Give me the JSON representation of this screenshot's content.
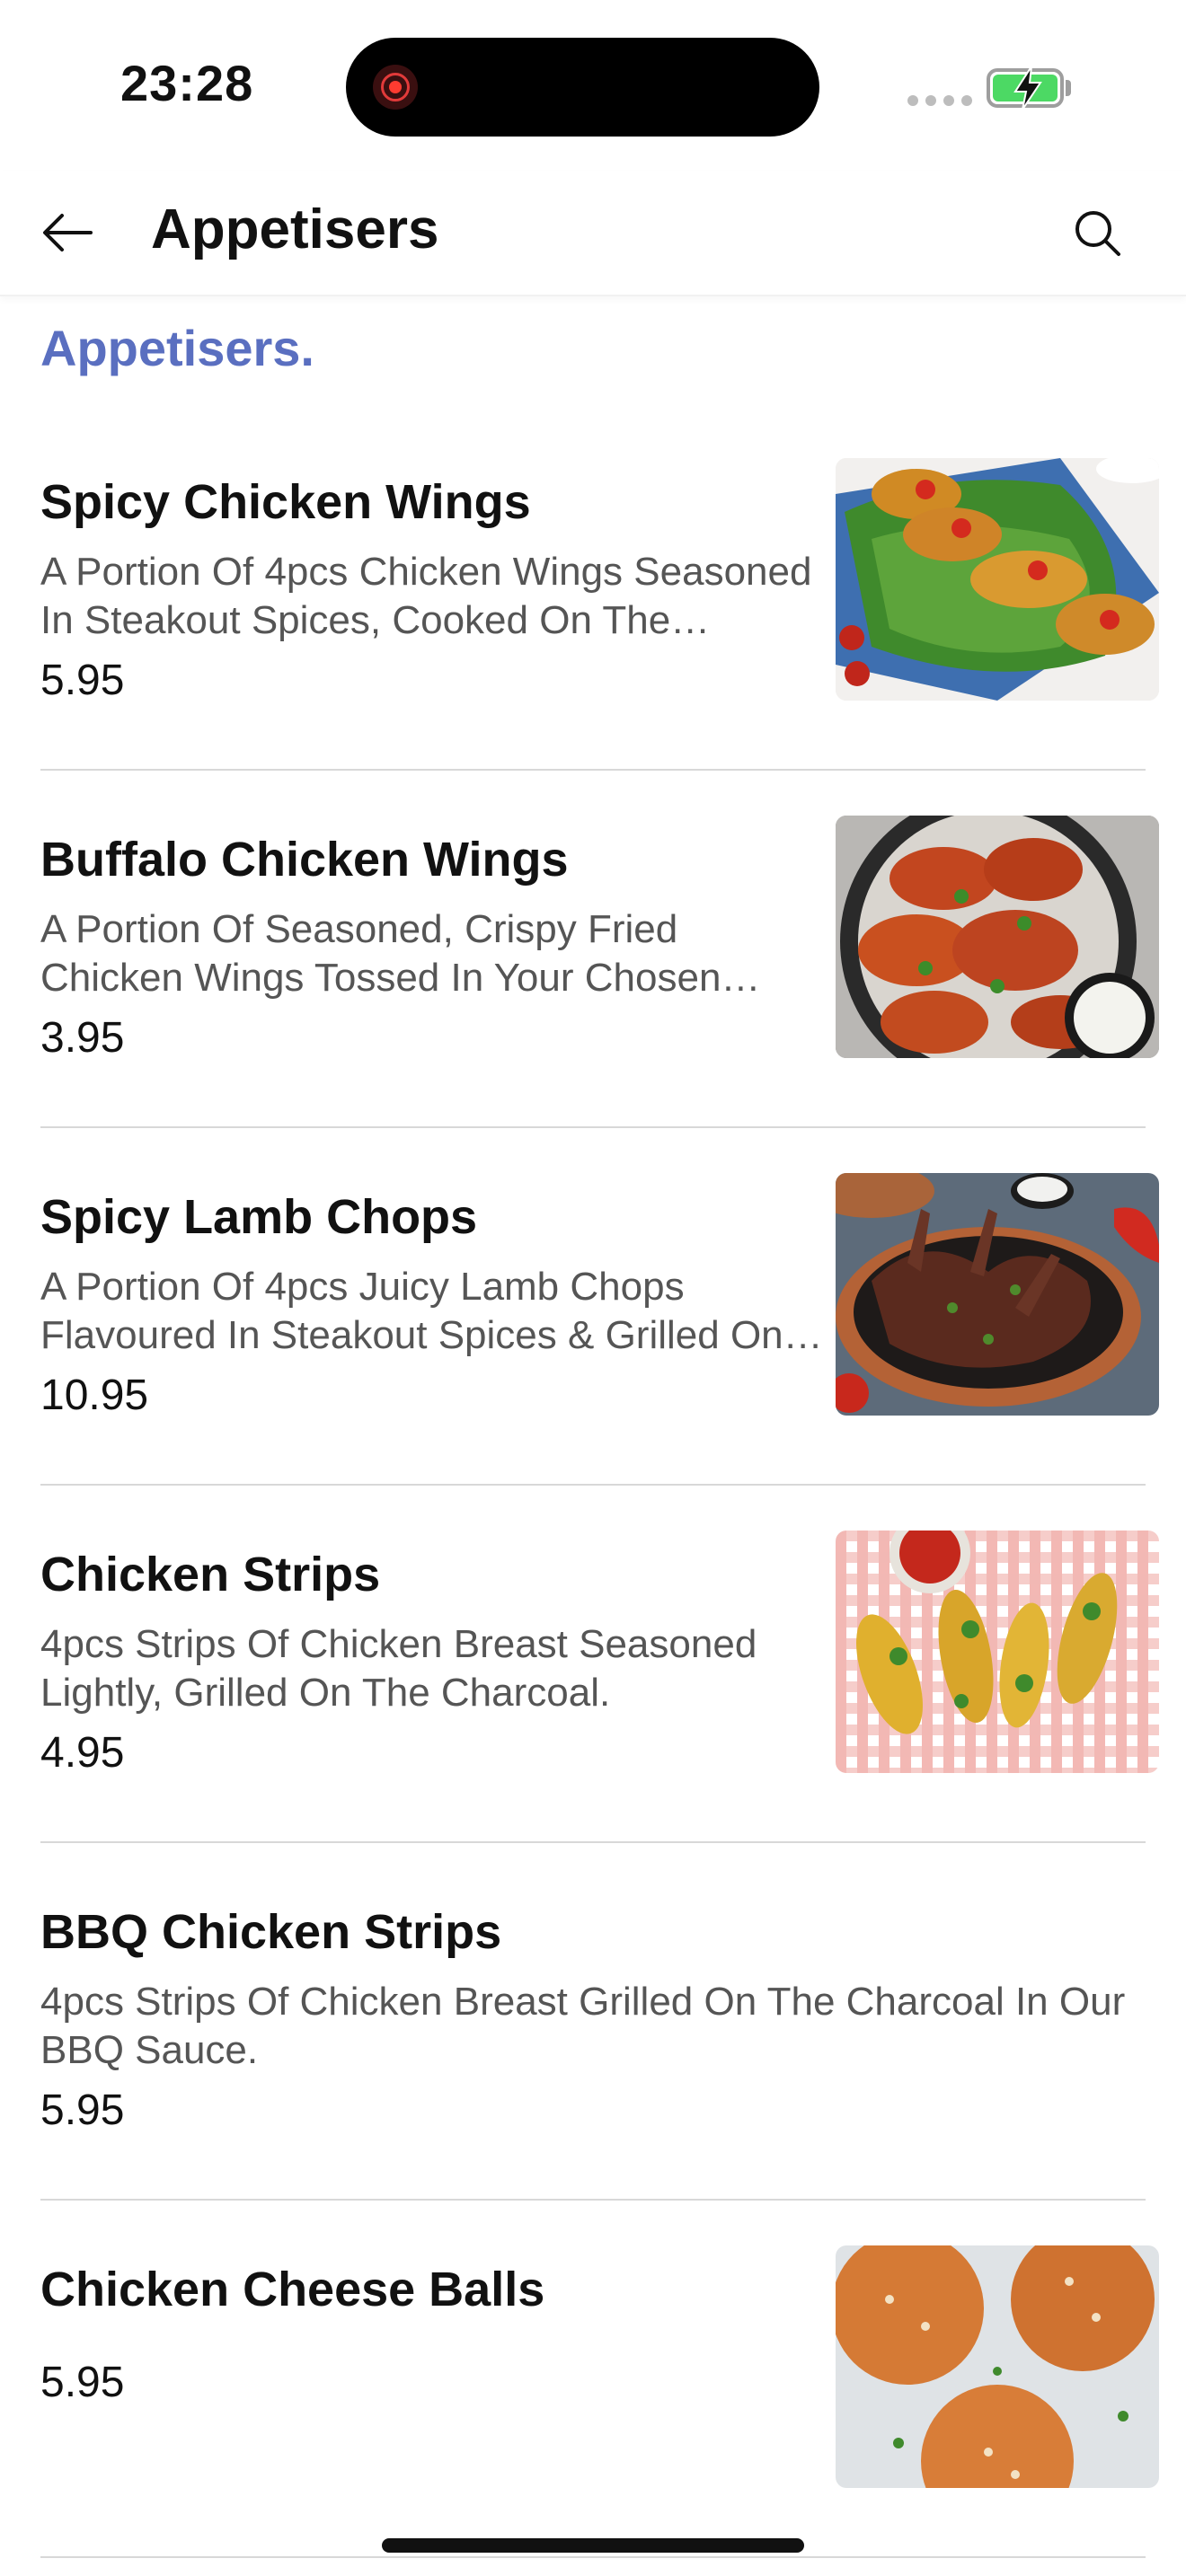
{
  "status_bar": {
    "time": "23:28"
  },
  "header": {
    "title": "Appetisers"
  },
  "section": {
    "heading": "Appetisers."
  },
  "items": [
    {
      "name": "Spicy Chicken Wings",
      "description": "A Portion Of 4pcs Chicken Wings Seasoned In Steakout Spices, Cooked On The Charcoal.",
      "price": "5.95",
      "image": "grilled-chicken-wings-photo"
    },
    {
      "name": "Buffalo Chicken Wings",
      "description": "A Portion Of Seasoned, Crispy Fried Chicken Wings Tossed In Your Chosen Sauce.",
      "price": "3.95",
      "image": "buffalo-wings-photo"
    },
    {
      "name": "Spicy Lamb Chops",
      "description": "A Portion Of 4pcs Juicy Lamb Chops Flavoured In Steakout Spices & Grilled On The Charcoal.",
      "price": "10.95",
      "image": "lamb-chops-photo"
    },
    {
      "name": "Chicken Strips",
      "description": "4pcs Strips Of Chicken Breast Seasoned Lightly, Grilled On The Charcoal.",
      "price": "4.95",
      "image": "chicken-strips-photo"
    },
    {
      "name": "BBQ Chicken Strips",
      "description": "4pcs Strips Of Chicken Breast Grilled On The Charcoal In Our BBQ Sauce.",
      "price": "5.95"
    },
    {
      "name": "Chicken Cheese Balls",
      "price": "5.95",
      "image": "cheese-balls-photo"
    }
  ],
  "colors": {
    "accent": "#5a6fc0",
    "text": "#111111",
    "muted": "#555555",
    "divider": "#d8d8d8",
    "battery": "#4cd964"
  },
  "icons": {
    "back": "arrow-left-icon",
    "search": "search-icon",
    "recording": "record-icon",
    "battery": "battery-charging-icon"
  }
}
